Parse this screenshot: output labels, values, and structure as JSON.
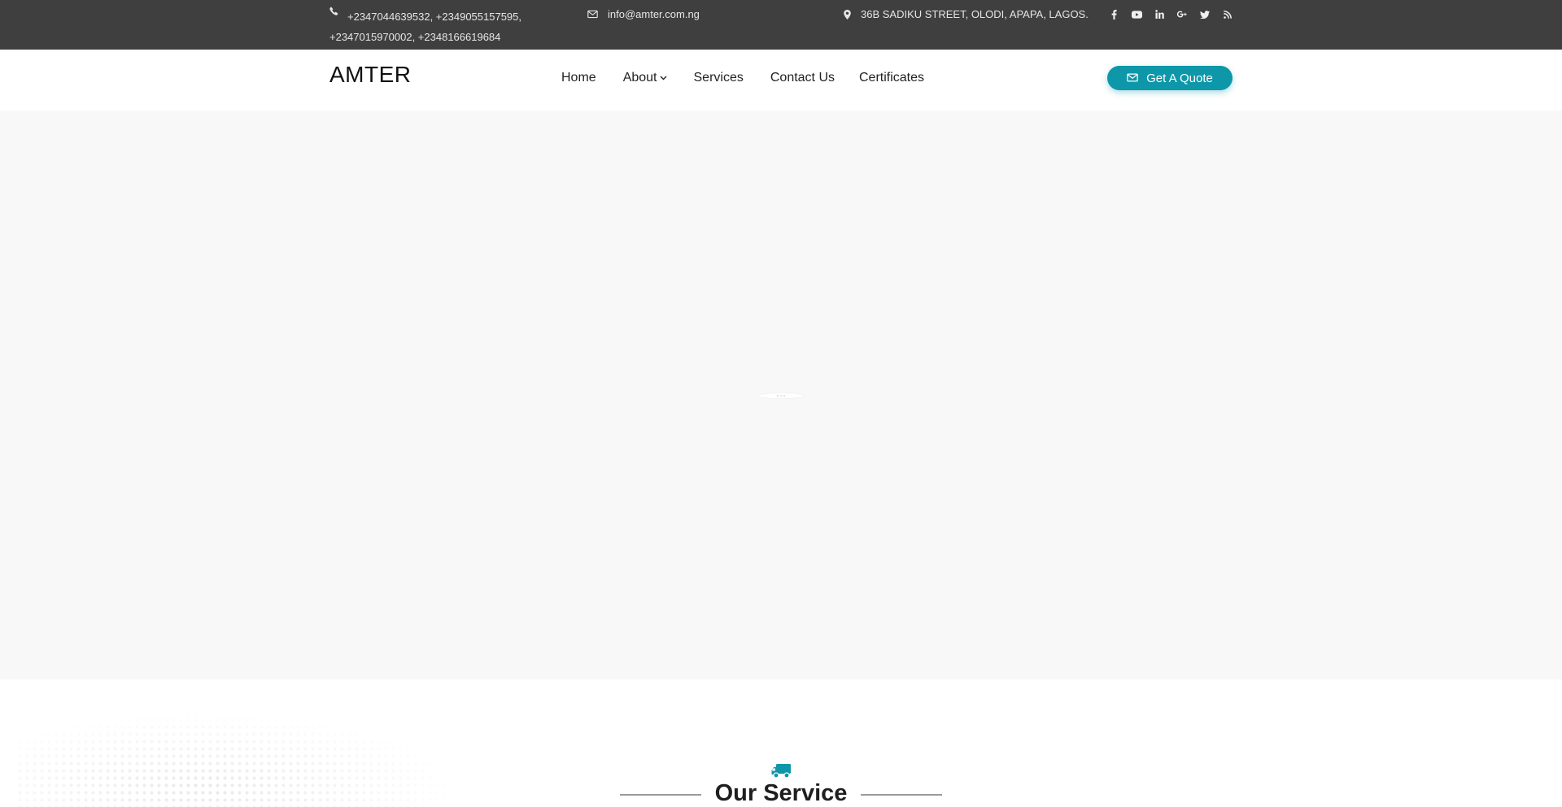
{
  "topbar": {
    "phone": "+2347044639532, +2349055157595, +2347015970002, +2348166619684",
    "email": "info@amter.com.ng",
    "address": "36B SADIKU STREET, OLODI, APAPA, LAGOS.",
    "social_icons": [
      "facebook-icon",
      "youtube-icon",
      "linkedin-icon",
      "google-plus-icon",
      "twitter-icon",
      "rss-icon"
    ]
  },
  "header": {
    "logo": "AMTER",
    "nav": [
      "Home",
      "About",
      "Services",
      "Contact Us",
      "Certificates"
    ],
    "quote_button": "Get A Quote"
  },
  "section": {
    "title": "Our Service",
    "icon": "truck-icon"
  },
  "colors": {
    "accent": "#0e97a8",
    "topbar_bg": "#3f3f3f",
    "hero_bg": "#f8f8f8"
  }
}
